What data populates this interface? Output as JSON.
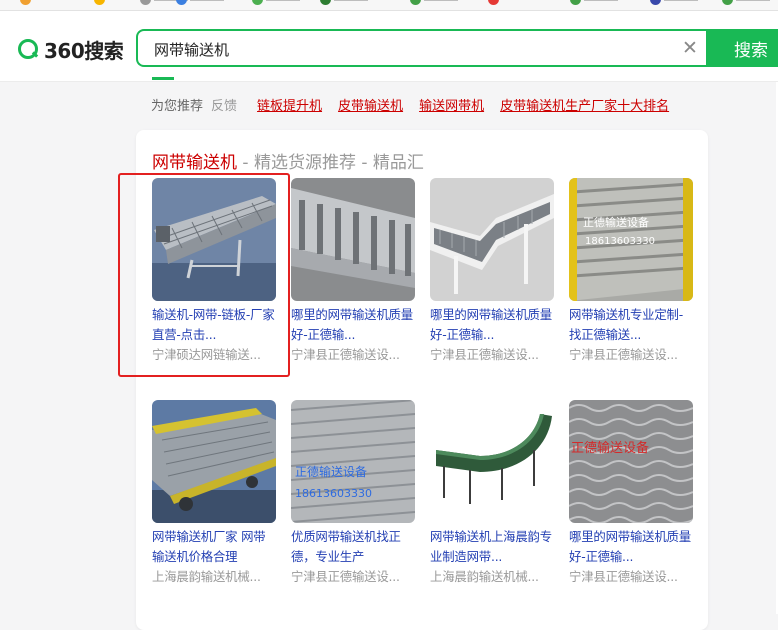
{
  "search": {
    "logo_text": "360搜索",
    "query": "网带输送机",
    "button_label": "搜索"
  },
  "related": {
    "label": "为您推荐",
    "feedback": "反馈",
    "links": [
      "链板提升机",
      "皮带输送机",
      "输送网带机",
      "皮带输送机生产厂家十大排名"
    ]
  },
  "card": {
    "title_highlight": "网带输送机",
    "title_rest": " - 精选货源推荐 - 精品汇",
    "items": [
      {
        "title": "输送机-网带-链板-厂家直营-点击...",
        "source": "宁津硕达网链输送..."
      },
      {
        "title": "哪里的网带输送机质量好-正德输...",
        "source": "宁津县正德输送设..."
      },
      {
        "title": "哪里的网带输送机质量好-正德输...",
        "source": "宁津县正德输送设..."
      },
      {
        "title": "网带输送机专业定制-找正德输送...",
        "source": "宁津县正德输送设..."
      },
      {
        "title": "网带输送机厂家 网带输送机价格合理",
        "source": "上海晨韵输送机械..."
      },
      {
        "title": "优质网带输送机找正德，专业生产",
        "source": "宁津县正德输送设..."
      },
      {
        "title": "网带输送机上海晨韵专业制造网带...",
        "source": "上海晨韵输送机械..."
      },
      {
        "title": "哪里的网带输送机质量好-正德输...",
        "source": "宁津县正德输送设..."
      }
    ],
    "watermarks": {
      "item4": [
        "正德输送设备",
        "18613603330"
      ],
      "item6": [
        "正德输送设备",
        "18613603330"
      ],
      "item8": "正德输送设备"
    }
  },
  "colors": {
    "accent": "#19b955",
    "link": "#2440b3",
    "highlight": "#cc0000",
    "annotation": "#e32020"
  }
}
